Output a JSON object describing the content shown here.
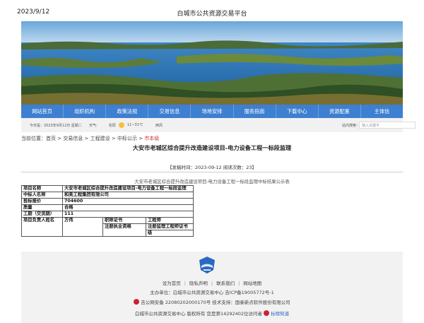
{
  "header": {
    "date": "2023/9/12",
    "site_title": "白城市公共资源交易平台"
  },
  "nav": {
    "items": [
      "网站首页",
      "组织机构",
      "政策法规",
      "交易信息",
      "场地安排",
      "服务指南",
      "下载中心",
      "资源配置",
      "主体信"
    ]
  },
  "infobar": {
    "date_text": "今天是：2023年9月12日  星期二",
    "weather_label": "天气:",
    "weather_text": "松原",
    "temperature": "11~31℃",
    "wind": "西风",
    "search_label": "站内搜索：",
    "search_placeholder": "输入关键字"
  },
  "breadcrumb": {
    "prefix": "当前位置：",
    "items": [
      "首页",
      "交易信息",
      "工程建设",
      "中标公示"
    ],
    "current": "市本级",
    "separator": " > "
  },
  "article": {
    "title": "大安市老城区综合提升改造建设项目-电力设备工程一标段监理",
    "meta": "【发稿时间：2023-09-12   阅读次数：23】",
    "subtitle": "大安市老城区综合提升改造建设项目-电力设备工程一标段监理中标结果公示表",
    "table": {
      "rows": [
        {
          "key": "项目名称",
          "value": "大安市老城区综合提升改造建设项目-电力设备工程一标段监理"
        },
        {
          "key": "中标人名称",
          "value": "和美工程集团有限公司"
        },
        {
          "key": "投标报价",
          "value": "704600"
        },
        {
          "key": "质量",
          "value": "合格"
        },
        {
          "key": "工期（交货期）",
          "value": "111"
        }
      ],
      "manager_label": "项目负责人姓名",
      "manager_name": "方伟",
      "cert_title_label": "职称证书",
      "cert_title_value": "工程师",
      "reg_label": "注册执业资格",
      "reg_value": "注册监理工程师证书",
      "reg_value_2": "级"
    }
  },
  "footer": {
    "links": [
      "设为首页",
      "隐私声明",
      "联系我们",
      "网站地图"
    ],
    "host": "主办单位：白城市公共资源交易中心  吉ICP备19005772号-1",
    "police": "吉公网安备 22080202000170号  技术支持：国泰新点软件股份有限公司",
    "copyright": "白城市公共资源交易中心 版权所有  您是第14292402位访问者",
    "care": "标榜知道"
  }
}
